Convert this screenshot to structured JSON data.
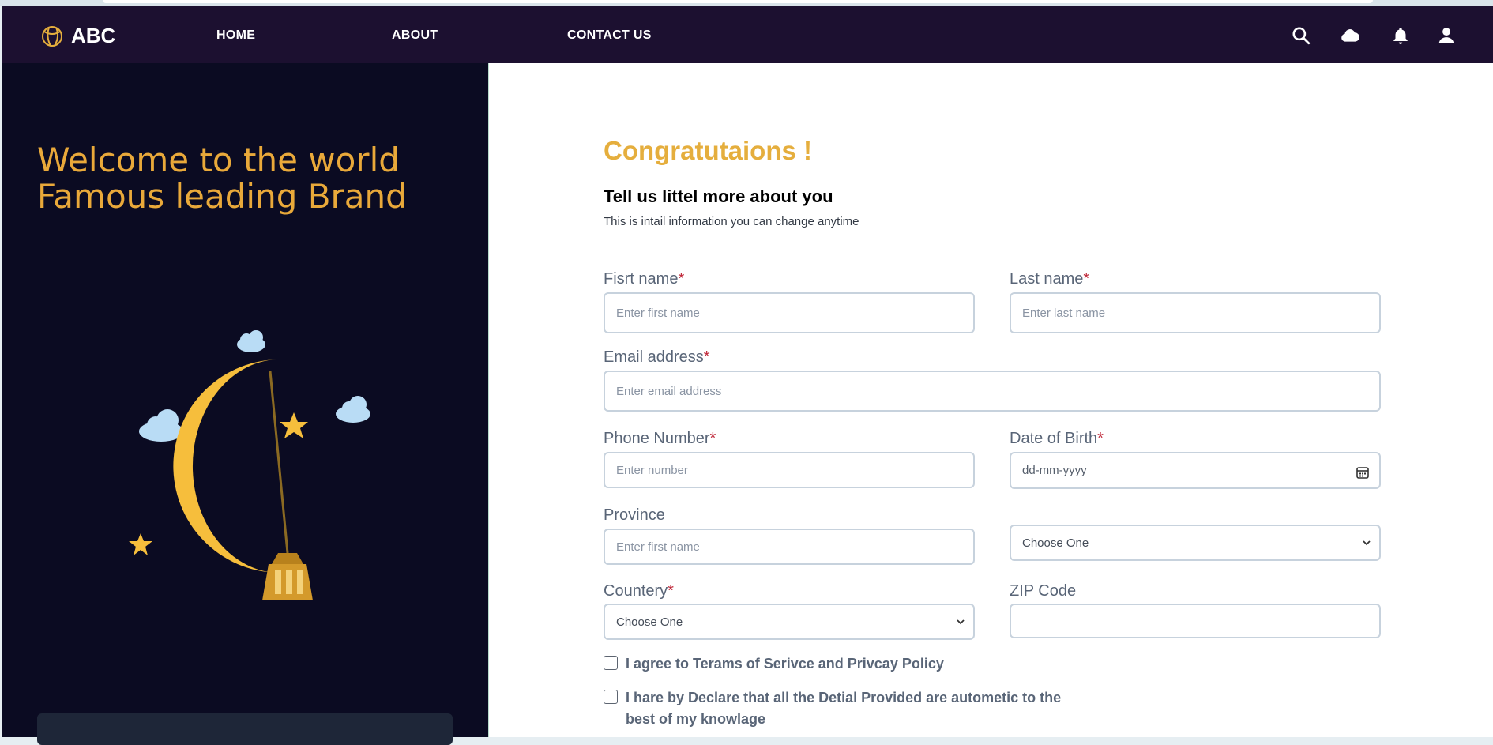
{
  "brand": {
    "name": "ABC",
    "logo_icon": "basketball-icon"
  },
  "nav": {
    "links": [
      "HOME",
      "ABOUT",
      "CONTACT US"
    ],
    "icons": [
      "search-icon",
      "cloud-icon",
      "bell-icon",
      "user-icon"
    ]
  },
  "hero": {
    "line1": "Welcome to the world",
    "line2": "Famous leading Brand"
  },
  "form": {
    "title": "Congratutaions !",
    "subtitle": "Tell us littel more about you",
    "description": "This is intail information you can change anytime",
    "first_name": {
      "label": "Fisrt name",
      "required_mark": "*",
      "placeholder": "Enter first name",
      "value": ""
    },
    "last_name": {
      "label": "Last name",
      "required_mark": "*",
      "placeholder": "Enter last name",
      "value": ""
    },
    "email": {
      "label": "Email address",
      "required_mark": "*",
      "placeholder": "Enter email address",
      "value": ""
    },
    "phone": {
      "label": "Phone Number",
      "required_mark": "*",
      "placeholder": "Enter number",
      "value": ""
    },
    "dob": {
      "label": "Date of Birth",
      "required_mark": "*",
      "value": "dd-mm-yyyy"
    },
    "province": {
      "label": "Province",
      "placeholder": "Enter first name",
      "value": ""
    },
    "province_select": {
      "label": ".",
      "selected": "Choose One"
    },
    "country": {
      "label": "Countery",
      "required_mark": "*",
      "selected": "Choose One"
    },
    "zip": {
      "label": "ZIP Code",
      "placeholder": "",
      "value": ""
    },
    "agree_terms": {
      "label": "I agree to Terams of Serivce and Privcay Policy",
      "checked": false
    },
    "declare": {
      "label_line1": "I hare by Declare that all the Detial Provided are autometic to the",
      "label_line2": "best of my knowlage",
      "checked": false
    }
  },
  "colors": {
    "navbar": "#1c1030",
    "left_panel": "#0b0b22",
    "accent_gold": "#e5ae3d",
    "required": "#c0293a",
    "label": "#596577"
  }
}
